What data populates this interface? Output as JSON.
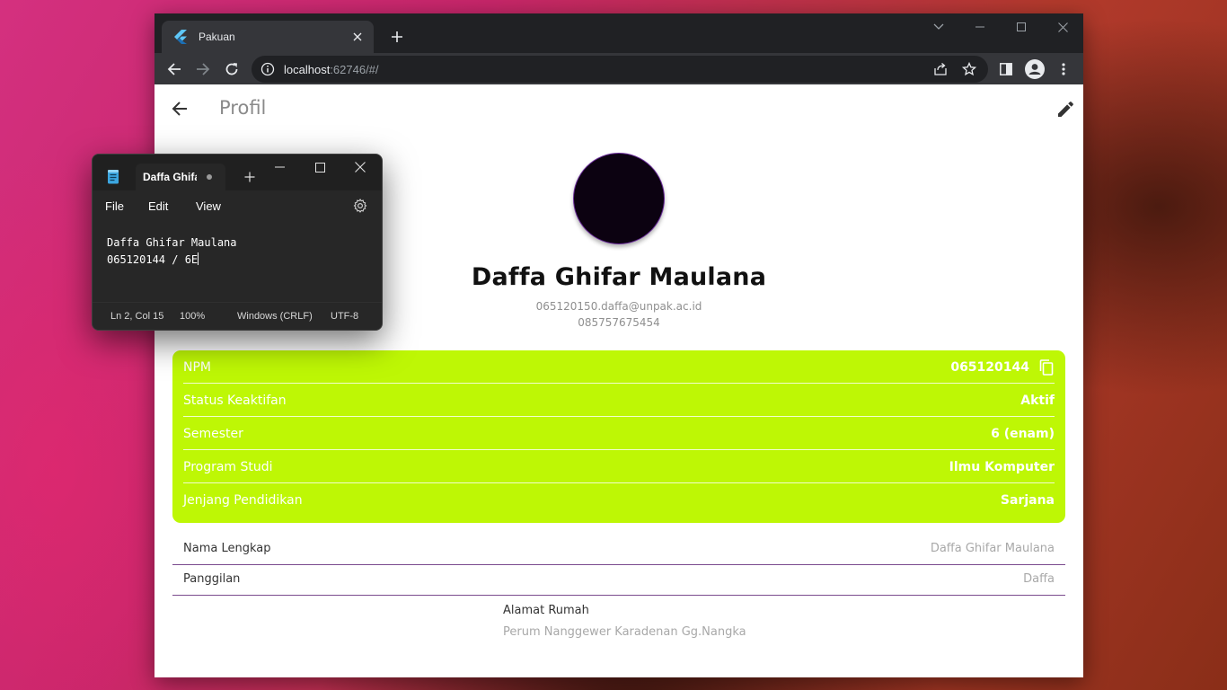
{
  "browser": {
    "tab_title": "Pakuan",
    "url_host": "localhost",
    "url_rest": ":62746/#/"
  },
  "app": {
    "title": "Profil",
    "profile": {
      "name": "Daffa Ghifar Maulana",
      "email": "065120150.daffa@unpak.ac.id",
      "phone": "085757675454"
    },
    "info_card": {
      "color": "#bef705",
      "rows": [
        {
          "label": "NPM",
          "value": "065120144"
        },
        {
          "label": "Status Keaktifan",
          "value": "Aktif"
        },
        {
          "label": "Semester",
          "value": "6 (enam)"
        },
        {
          "label": "Program Studi",
          "value": "Ilmu Komputer"
        },
        {
          "label": "Jenjang Pendidikan",
          "value": "Sarjana"
        }
      ]
    },
    "details": [
      {
        "label": "Nama Lengkap",
        "value": "Daffa Ghifar Maulana"
      },
      {
        "label": "Panggilan",
        "value": "Daffa"
      }
    ],
    "address": {
      "label": "Alamat Rumah",
      "value": "Perum Nanggewer Karadenan Gg.Nangka"
    }
  },
  "notepad": {
    "tab_title": "Daffa Ghifar Maulana",
    "menu": [
      "File",
      "Edit",
      "View"
    ],
    "lines": [
      "Daffa Ghifar Maulana",
      "065120144 / 6E"
    ],
    "status": {
      "position": "Ln 2, Col 15",
      "zoom": "100%",
      "line_ending": "Windows (CRLF)",
      "encoding": "UTF-8"
    }
  }
}
